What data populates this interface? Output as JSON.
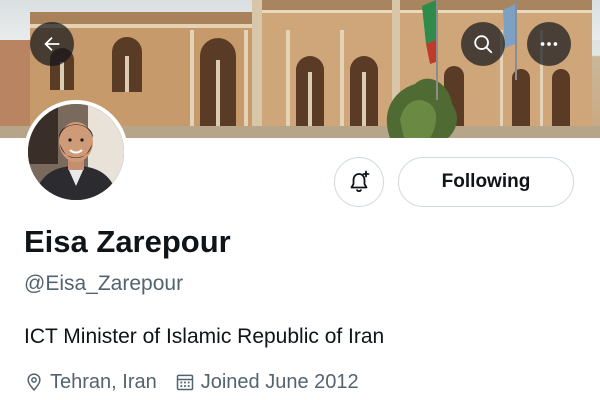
{
  "header": {
    "back_icon": "arrow-left-icon",
    "search_icon": "search-icon",
    "more_icon": "more-horizontal-icon"
  },
  "profile": {
    "display_name": "Eisa Zarepour",
    "handle": "@Eisa_Zarepour",
    "bio": "ICT Minister of Islamic Republic of Iran",
    "location": "Tehran, Iran",
    "joined": "Joined June 2012"
  },
  "actions": {
    "notify_icon": "bell-plus-icon",
    "following_label": "Following"
  },
  "colors": {
    "text_primary": "#0f1419",
    "text_secondary": "#536471",
    "border": "#cfd9de"
  }
}
